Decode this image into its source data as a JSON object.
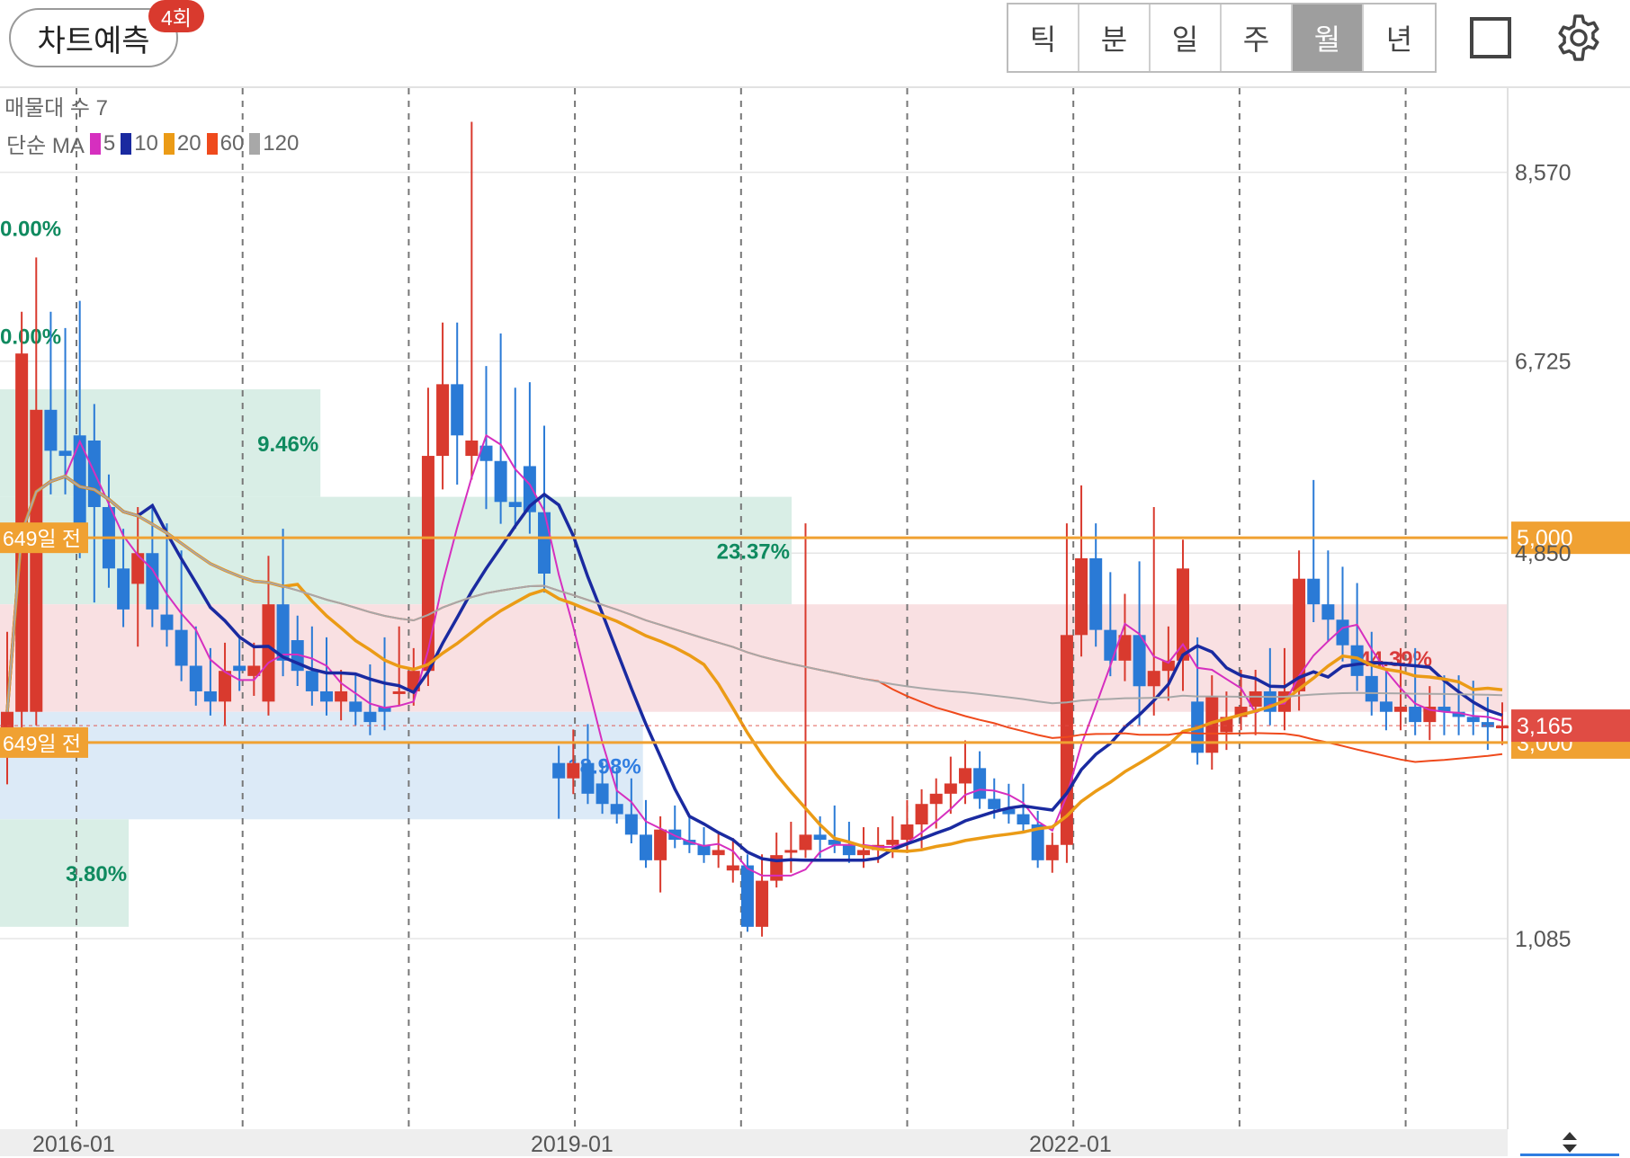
{
  "toolbar": {
    "predict_label": "차트예측",
    "predict_badge": "4회",
    "periods": [
      "틱",
      "분",
      "일",
      "주",
      "월",
      "년"
    ],
    "active_period": "월"
  },
  "legend": {
    "volume_profile": "매물대 수 7",
    "ma_label": "단순 MA",
    "ma_items": [
      {
        "period": "5",
        "color": "#d62fbf"
      },
      {
        "period": "10",
        "color": "#1a2aa0"
      },
      {
        "period": "20",
        "color": "#eb9b16"
      },
      {
        "period": "60",
        "color": "#ef4a1c"
      },
      {
        "period": "120",
        "color": "#a8a8a8"
      }
    ]
  },
  "chart_data": {
    "type": "candlestick",
    "interval": "monthly",
    "y_ticks": [
      8570,
      6725,
      4850,
      1085
    ],
    "y_tick_labels": [
      "8,570",
      "6,725",
      "4,850",
      "1,085"
    ],
    "ylim": [
      430,
      9500
    ],
    "x_tick_labels": [
      "2016-01",
      "2019-01",
      "2022-01"
    ],
    "current_price": {
      "value": 3165,
      "label": "3,165",
      "color": "#e04c44"
    },
    "horizontal_lines": [
      {
        "value": 5000,
        "label": "5,000",
        "left_label": "649일 전",
        "color": "#f0a132"
      },
      {
        "value": 3000,
        "label": "3,000",
        "left_label": "649일 전",
        "color": "#f0a132"
      }
    ],
    "volume_profile_bands": [
      {
        "from": 5400,
        "to": 6450,
        "percent": "9.46%",
        "color": "green"
      },
      {
        "from": 4350,
        "to": 5400,
        "percent": "23.37%",
        "color": "green"
      },
      {
        "from": 3300,
        "to": 4350,
        "percent": "44.39%",
        "color": "red"
      },
      {
        "from": 2250,
        "to": 3300,
        "percent": "18.98%",
        "color": "blue"
      },
      {
        "from": 1200,
        "to": 2250,
        "percent": "3.80%",
        "color": "green"
      },
      {
        "from": 7500,
        "to": 8550,
        "percent": "0.00%",
        "color": "green"
      },
      {
        "from": 6450,
        "to": 7500,
        "percent": "0.00%",
        "color": "green"
      }
    ],
    "candles": [
      [
        3000,
        3850,
        2700,
        3300
      ],
      [
        3300,
        5000,
        3250,
        6800
      ],
      [
        3300,
        7300,
        3300,
        6250
      ],
      [
        6250,
        6800,
        5650,
        5850
      ],
      [
        5850,
        6650,
        5650,
        5800
      ],
      [
        6000,
        6900,
        5300,
        5000
      ],
      [
        5950,
        5800,
        4550,
        5300
      ],
      [
        5300,
        5000,
        4900,
        4700
      ],
      [
        4700,
        4800,
        4800,
        4300
      ],
      [
        4550,
        5000,
        4100,
        4850
      ],
      [
        4850,
        5000,
        4700,
        4300
      ],
      [
        4250,
        4850,
        4200,
        4100
      ],
      [
        4100,
        4600,
        3950,
        3750
      ],
      [
        3750,
        3900,
        3500,
        3500
      ],
      [
        3500,
        3700,
        3400,
        3400
      ],
      [
        3400,
        3750,
        3300,
        3700
      ],
      [
        3750,
        3800,
        3650,
        3700
      ],
      [
        3650,
        3750,
        3600,
        3750
      ],
      [
        3400,
        4550,
        3400,
        4350
      ],
      [
        4350,
        4000,
        4800,
        3800
      ],
      [
        4000,
        4000,
        3850,
        3700
      ],
      [
        3700,
        3900,
        3600,
        3500
      ],
      [
        3500,
        3800,
        3400,
        3400
      ],
      [
        3400,
        3500,
        3350,
        3500
      ],
      [
        3400,
        3450,
        3400,
        3300
      ],
      [
        3300,
        3550,
        3450,
        3200
      ],
      [
        3350,
        3800,
        3250,
        3300
      ],
      [
        3500,
        3900,
        3800,
        3500
      ],
      [
        3500,
        3700,
        3600,
        3700
      ],
      [
        3700,
        6100,
        3700,
        5800
      ],
      [
        5800,
        6700,
        5700,
        6500
      ],
      [
        6500,
        6700,
        5750,
        6000
      ],
      [
        5800,
        5800,
        8550,
        5950
      ],
      [
        5900,
        6300,
        5500,
        5750
      ],
      [
        5750,
        6600,
        5500,
        5350
      ],
      [
        5350,
        6100,
        5300,
        5300
      ],
      [
        5700,
        5700,
        6150,
        5250
      ],
      [
        5250,
        5250,
        5750,
        4650
      ],
      [
        2800,
        2800,
        2350,
        2650
      ],
      [
        2650,
        2950,
        2600,
        2800
      ],
      [
        2800,
        2700,
        3000,
        2500
      ],
      [
        2600,
        2650,
        2550,
        2400
      ],
      [
        2400,
        2600,
        2500,
        2300
      ],
      [
        2300,
        2500,
        2250,
        2100
      ],
      [
        2100,
        2300,
        2050,
        1850
      ],
      [
        1850,
        1800,
        1600,
        2150
      ],
      [
        2150,
        2100,
        2250,
        2050
      ],
      [
        2050,
        2150,
        2150,
        2000
      ],
      [
        2000,
        2050,
        2000,
        1900
      ],
      [
        1900,
        2000,
        1850,
        1950
      ],
      [
        1750,
        1950,
        1700,
        1800
      ],
      [
        1800,
        1500,
        1350,
        1200
      ],
      [
        1200,
        1800,
        1150,
        1650
      ],
      [
        1650,
        2000,
        1650,
        1900
      ],
      [
        1950,
        2100,
        1800,
        1950
      ],
      [
        1950,
        4850,
        1950,
        2100
      ],
      [
        2100,
        2150,
        1950,
        2050
      ],
      [
        2050,
        2250,
        2000,
        2000
      ],
      [
        2000,
        2100,
        1950,
        1900
      ],
      [
        1900,
        2050,
        1850,
        1950
      ],
      [
        1950,
        2050,
        1900,
        2000
      ],
      [
        2000,
        2150,
        1950,
        2050
      ],
      [
        2050,
        2300,
        2000,
        2200
      ],
      [
        2200,
        2350,
        2050,
        2400
      ],
      [
        2400,
        2250,
        2350,
        2500
      ],
      [
        2500,
        2700,
        2400,
        2600
      ],
      [
        2600,
        2850,
        2500,
        2750
      ],
      [
        2750,
        2600,
        2700,
        2450
      ],
      [
        2450,
        2500,
        2400,
        2350
      ],
      [
        2350,
        2450,
        2300,
        2300
      ],
      [
        2300,
        2450,
        2250,
        2200
      ],
      [
        2200,
        2150,
        1950,
        1850
      ],
      [
        1850,
        2000,
        1800,
        2000
      ],
      [
        2000,
        4850,
        1900,
        4050
      ],
      [
        4050,
        5200,
        4000,
        4800
      ],
      [
        4800,
        4850,
        4400,
        4100
      ],
      [
        4100,
        4400,
        3950,
        3800
      ],
      [
        3800,
        4200,
        3750,
        4050
      ],
      [
        4050,
        4500,
        3300,
        3550
      ],
      [
        3550,
        5000,
        3400,
        3700
      ],
      [
        3700,
        3900,
        3550,
        3800
      ],
      [
        3800,
        4050,
        3650,
        4700
      ],
      [
        3400,
        3800,
        3350,
        2900
      ],
      [
        2900,
        3200,
        2850,
        3450
      ],
      [
        3100,
        3300,
        3050,
        3250
      ],
      [
        3250,
        3500,
        3250,
        3350
      ],
      [
        3350,
        3500,
        3200,
        3500
      ],
      [
        3500,
        3700,
        3300,
        3300
      ],
      [
        3300,
        3700,
        3250,
        3500
      ],
      [
        3500,
        4250,
        3450,
        4600
      ],
      [
        4600,
        5250,
        4550,
        4350
      ],
      [
        4350,
        4600,
        4150,
        4200
      ],
      [
        4200,
        4450,
        4100,
        3950
      ],
      [
        3950,
        4300,
        3800,
        3650
      ],
      [
        3650,
        3850,
        3500,
        3400
      ],
      [
        3400,
        3500,
        3250,
        3300
      ],
      [
        3300,
        3700,
        3250,
        3350
      ],
      [
        3350,
        3700,
        3300,
        3200
      ],
      [
        3200,
        3300,
        3150,
        3350
      ],
      [
        3350,
        3450,
        3200,
        3300
      ],
      [
        3300,
        3450,
        3200,
        3250
      ],
      [
        3250,
        3400,
        3200,
        3200
      ],
      [
        3200,
        3250,
        3050,
        3150
      ],
      [
        3150,
        3200,
        3100,
        3165
      ]
    ]
  }
}
